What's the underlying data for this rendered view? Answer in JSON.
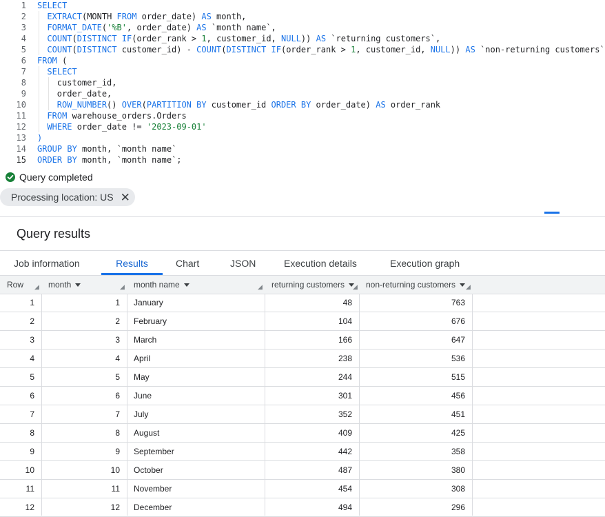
{
  "editor": {
    "line_numbers": [
      "1",
      "2",
      "3",
      "4",
      "5",
      "6",
      "7",
      "8",
      "9",
      "10",
      "11",
      "12",
      "13",
      "14",
      "15"
    ],
    "lines": [
      [
        {
          "t": "kw",
          "v": "SELECT"
        }
      ],
      [
        {
          "t": "fn",
          "v": "EXTRACT"
        },
        {
          "t": "id",
          "v": "(MONTH "
        },
        {
          "t": "kw",
          "v": "FROM"
        },
        {
          "t": "id",
          "v": " order_date) "
        },
        {
          "t": "kw",
          "v": "AS"
        },
        {
          "t": "id",
          "v": " month,"
        }
      ],
      [
        {
          "t": "fn",
          "v": "FORMAT_DATE"
        },
        {
          "t": "id",
          "v": "("
        },
        {
          "t": "str",
          "v": "'%B'"
        },
        {
          "t": "id",
          "v": ", order_date) "
        },
        {
          "t": "kw",
          "v": "AS"
        },
        {
          "t": "id",
          "v": " `month name`,"
        }
      ],
      [
        {
          "t": "fn",
          "v": "COUNT"
        },
        {
          "t": "id",
          "v": "("
        },
        {
          "t": "kw",
          "v": "DISTINCT"
        },
        {
          "t": "id",
          "v": " "
        },
        {
          "t": "fn",
          "v": "IF"
        },
        {
          "t": "id",
          "v": "(order_rank > "
        },
        {
          "t": "num",
          "v": "1"
        },
        {
          "t": "id",
          "v": ", customer_id, "
        },
        {
          "t": "kw",
          "v": "NULL"
        },
        {
          "t": "id",
          "v": ")) "
        },
        {
          "t": "kw",
          "v": "AS"
        },
        {
          "t": "id",
          "v": " `returning customers`,"
        }
      ],
      [
        {
          "t": "fn",
          "v": "COUNT"
        },
        {
          "t": "id",
          "v": "("
        },
        {
          "t": "kw",
          "v": "DISTINCT"
        },
        {
          "t": "id",
          "v": " customer_id) - "
        },
        {
          "t": "fn",
          "v": "COUNT"
        },
        {
          "t": "id",
          "v": "("
        },
        {
          "t": "kw",
          "v": "DISTINCT"
        },
        {
          "t": "id",
          "v": " "
        },
        {
          "t": "fn",
          "v": "IF"
        },
        {
          "t": "id",
          "v": "(order_rank > "
        },
        {
          "t": "num",
          "v": "1"
        },
        {
          "t": "id",
          "v": ", customer_id, "
        },
        {
          "t": "kw",
          "v": "NULL"
        },
        {
          "t": "id",
          "v": ")) "
        },
        {
          "t": "kw",
          "v": "AS"
        },
        {
          "t": "id",
          "v": " `non-returning customers`"
        }
      ],
      [
        {
          "t": "kw",
          "v": "FROM"
        },
        {
          "t": "id",
          "v": " ("
        }
      ],
      [
        {
          "t": "kw",
          "v": "SELECT"
        }
      ],
      [
        {
          "t": "id",
          "v": "customer_id,"
        }
      ],
      [
        {
          "t": "id",
          "v": "order_date,"
        }
      ],
      [
        {
          "t": "fn",
          "v": "ROW_NUMBER"
        },
        {
          "t": "id",
          "v": "() "
        },
        {
          "t": "kw",
          "v": "OVER"
        },
        {
          "t": "id",
          "v": "("
        },
        {
          "t": "kw",
          "v": "PARTITION BY"
        },
        {
          "t": "id",
          "v": " customer_id "
        },
        {
          "t": "kw",
          "v": "ORDER BY"
        },
        {
          "t": "id",
          "v": " order_date) "
        },
        {
          "t": "kw",
          "v": "AS"
        },
        {
          "t": "id",
          "v": " order_rank"
        }
      ],
      [
        {
          "t": "kw",
          "v": "FROM"
        },
        {
          "t": "id",
          "v": " warehouse_orders.Orders"
        }
      ],
      [
        {
          "t": "kw",
          "v": "WHERE"
        },
        {
          "t": "id",
          "v": " order_date != "
        },
        {
          "t": "str",
          "v": "'2023-09-01'"
        }
      ],
      [
        {
          "t": "kw",
          "v": ")"
        }
      ],
      [
        {
          "t": "kw",
          "v": "GROUP BY"
        },
        {
          "t": "id",
          "v": " month, `month name`"
        }
      ],
      [
        {
          "t": "kw",
          "v": "ORDER BY"
        },
        {
          "t": "id",
          "v": " month, `month name`;"
        }
      ]
    ]
  },
  "status": {
    "message": "Query completed",
    "location_chip": "Processing location: US",
    "chip_close": "✕"
  },
  "results": {
    "title": "Query results",
    "tabs": [
      "Job information",
      "Results",
      "Chart",
      "JSON",
      "Execution details",
      "Execution graph"
    ],
    "active_tab": "Results",
    "columns": [
      "Row",
      "month",
      "month name",
      "returning customers",
      "non-returning customers"
    ],
    "rows": [
      [
        "1",
        "1",
        "January",
        "48",
        "763"
      ],
      [
        "2",
        "2",
        "February",
        "104",
        "676"
      ],
      [
        "3",
        "3",
        "March",
        "166",
        "647"
      ],
      [
        "4",
        "4",
        "April",
        "238",
        "536"
      ],
      [
        "5",
        "5",
        "May",
        "244",
        "515"
      ],
      [
        "6",
        "6",
        "June",
        "301",
        "456"
      ],
      [
        "7",
        "7",
        "July",
        "352",
        "451"
      ],
      [
        "8",
        "8",
        "August",
        "409",
        "425"
      ],
      [
        "9",
        "9",
        "September",
        "442",
        "358"
      ],
      [
        "10",
        "10",
        "October",
        "487",
        "380"
      ],
      [
        "11",
        "11",
        "November",
        "454",
        "308"
      ],
      [
        "12",
        "12",
        "December",
        "494",
        "296"
      ]
    ]
  },
  "colors": {
    "accent": "#1a73e8",
    "success": "#188038"
  }
}
